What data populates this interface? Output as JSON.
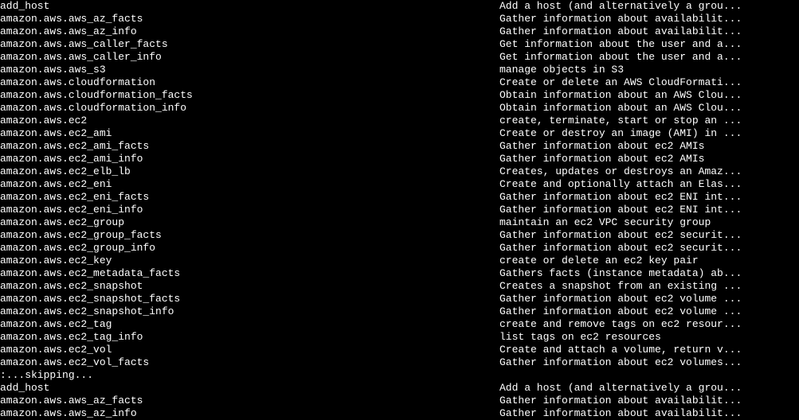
{
  "rows": [
    {
      "name": "add_host",
      "desc": "Add a host (and alternatively a grou..."
    },
    {
      "name": "amazon.aws.aws_az_facts",
      "desc": "Gather information about availabilit..."
    },
    {
      "name": "amazon.aws.aws_az_info",
      "desc": "Gather information about availabilit..."
    },
    {
      "name": "amazon.aws.aws_caller_facts",
      "desc": "Get information about the user and a..."
    },
    {
      "name": "amazon.aws.aws_caller_info",
      "desc": "Get information about the user and a..."
    },
    {
      "name": "amazon.aws.aws_s3",
      "desc": "manage objects in S3"
    },
    {
      "name": "amazon.aws.cloudformation",
      "desc": "Create or delete an AWS CloudFormati..."
    },
    {
      "name": "amazon.aws.cloudformation_facts",
      "desc": "Obtain information about an AWS Clou..."
    },
    {
      "name": "amazon.aws.cloudformation_info",
      "desc": "Obtain information about an AWS Clou..."
    },
    {
      "name": "amazon.aws.ec2",
      "desc": "create, terminate, start or stop an ..."
    },
    {
      "name": "amazon.aws.ec2_ami",
      "desc": "Create or destroy an image (AMI) in ..."
    },
    {
      "name": "amazon.aws.ec2_ami_facts",
      "desc": "Gather information about ec2 AMIs"
    },
    {
      "name": "amazon.aws.ec2_ami_info",
      "desc": "Gather information about ec2 AMIs"
    },
    {
      "name": "amazon.aws.ec2_elb_lb",
      "desc": "Creates, updates or destroys an Amaz..."
    },
    {
      "name": "amazon.aws.ec2_eni",
      "desc": "Create and optionally attach an Elas..."
    },
    {
      "name": "amazon.aws.ec2_eni_facts",
      "desc": "Gather information about ec2 ENI int..."
    },
    {
      "name": "amazon.aws.ec2_eni_info",
      "desc": "Gather information about ec2 ENI int..."
    },
    {
      "name": "amazon.aws.ec2_group",
      "desc": "maintain an ec2 VPC security group"
    },
    {
      "name": "amazon.aws.ec2_group_facts",
      "desc": "Gather information about ec2 securit..."
    },
    {
      "name": "amazon.aws.ec2_group_info",
      "desc": "Gather information about ec2 securit..."
    },
    {
      "name": "amazon.aws.ec2_key",
      "desc": "create or delete an ec2 key pair"
    },
    {
      "name": "amazon.aws.ec2_metadata_facts",
      "desc": "Gathers facts (instance metadata) ab..."
    },
    {
      "name": "amazon.aws.ec2_snapshot",
      "desc": "Creates a snapshot from an existing ..."
    },
    {
      "name": "amazon.aws.ec2_snapshot_facts",
      "desc": "Gather information about ec2 volume ..."
    },
    {
      "name": "amazon.aws.ec2_snapshot_info",
      "desc": "Gather information about ec2 volume ..."
    },
    {
      "name": "amazon.aws.ec2_tag",
      "desc": "create and remove tags on ec2 resour..."
    },
    {
      "name": "amazon.aws.ec2_tag_info",
      "desc": "list tags on ec2 resources"
    },
    {
      "name": "amazon.aws.ec2_vol",
      "desc": "Create and attach a volume, return v..."
    },
    {
      "name": "amazon.aws.ec2_vol_facts",
      "desc": "Gather information about ec2 volumes..."
    },
    {
      "name": ":...skipping...",
      "desc": ""
    },
    {
      "name": "add_host",
      "desc": "Add a host (and alternatively a grou..."
    },
    {
      "name": "amazon.aws.aws_az_facts",
      "desc": "Gather information about availabilit..."
    },
    {
      "name": "amazon.aws.aws_az_info",
      "desc": "Gather information about availabilit..."
    }
  ]
}
